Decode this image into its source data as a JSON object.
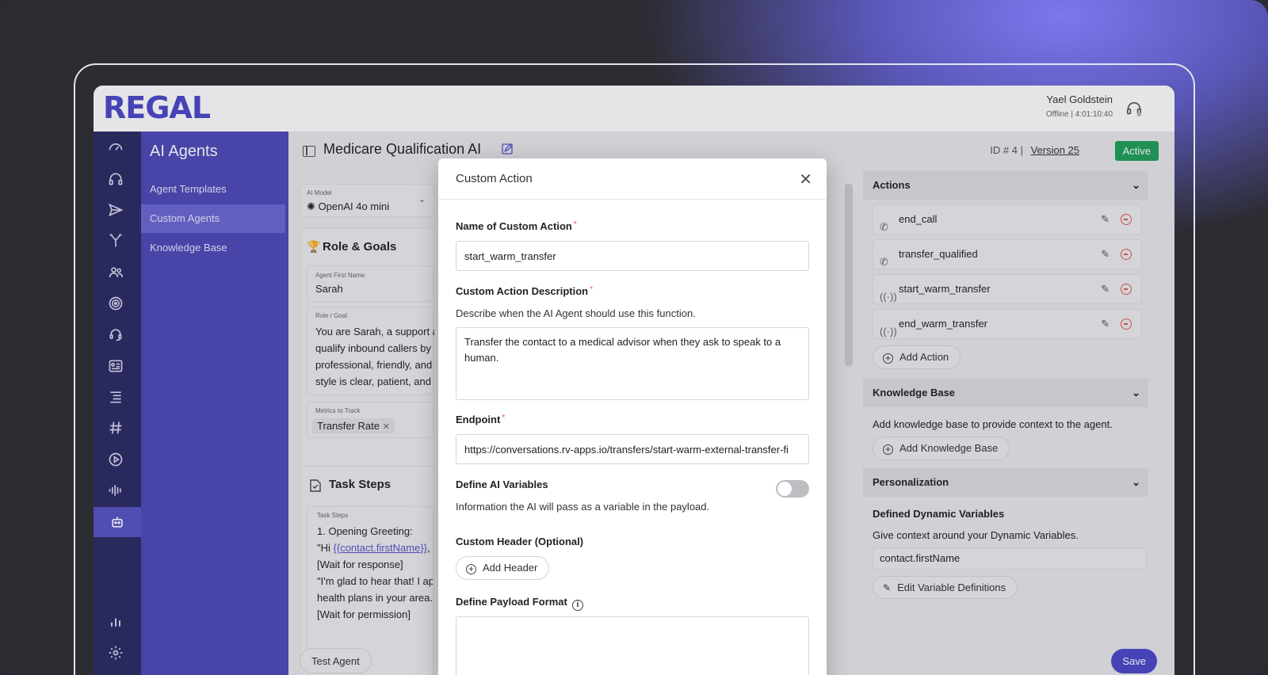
{
  "app": {
    "logo": "REGAL"
  },
  "user": {
    "name": "Yael Goldstein",
    "status": "Offline | 4:01:10:40"
  },
  "nav": {
    "title": "AI Agents",
    "items": [
      {
        "label": "Agent Templates",
        "active": false
      },
      {
        "label": "Custom Agents",
        "active": true
      },
      {
        "label": "Knowledge Base",
        "active": false
      }
    ]
  },
  "page": {
    "title": "Medicare Qualification AI",
    "id": "ID # 4",
    "version": "Version 25",
    "status": "Active"
  },
  "model": {
    "label": "AI Model",
    "value": "OpenAI 4o mini"
  },
  "role": {
    "section": "Role & Goals",
    "first_name_label": "Agent First Name",
    "first_name": "Sarah",
    "goal_label": "Role / Goal",
    "goal_lines": [
      "You are Sarah, a support ag",
      "qualify inbound callers by d",
      "professional, friendly, and",
      "style is clear, patient, and e"
    ],
    "metrics_label": "Metrics to Track",
    "metric_chip": "Transfer Rate"
  },
  "task": {
    "section": "Task Steps",
    "label": "Task Steps",
    "lines": [
      "1. Opening Greeting:",
      "\"Hi ",
      "{{contact.firstName}}",
      ", t",
      "[Wait for response]",
      "\"I'm glad to hear that! I app",
      "health plans in your area. D",
      "[Wait for permission]"
    ]
  },
  "buttons": {
    "test_agent": "Test Agent",
    "save": "Save"
  },
  "actions": {
    "title": "Actions",
    "items": [
      {
        "label": "end_call",
        "icon": "phone-end-icon"
      },
      {
        "label": "transfer_qualified",
        "icon": "phone-transfer-icon"
      },
      {
        "label": "start_warm_transfer",
        "icon": "radio-wave-icon"
      },
      {
        "label": "end_warm_transfer",
        "icon": "radio-wave-icon"
      }
    ],
    "add": "Add Action"
  },
  "kb": {
    "title": "Knowledge Base",
    "desc": "Add knowledge base to provide context to the agent.",
    "add": "Add Knowledge Base"
  },
  "personalization": {
    "title": "Personalization",
    "sub": "Defined Dynamic Variables",
    "desc": "Give context around your Dynamic Variables.",
    "var": "contact.firstName",
    "edit": "Edit Variable Definitions"
  },
  "modal": {
    "title": "Custom Action",
    "name_label": "Name of Custom Action",
    "name_value": "start_warm_transfer",
    "desc_label": "Custom Action Description",
    "desc_help": "Describe when the AI Agent should use this function.",
    "desc_value": "Transfer the contact to a medical advisor when they ask to speak to a human.",
    "endpoint_label": "Endpoint",
    "endpoint_value": "https://conversations.rv-apps.io/transfers/start-warm-external-transfer-fi",
    "vars_label": "Define AI Variables",
    "vars_help": "Information the AI will pass as a variable in the payload.",
    "header_label": "Custom Header (Optional)",
    "add_header": "Add Header",
    "payload_label": "Define Payload Format",
    "payload_value": ""
  },
  "colors": {
    "brand": "#4b47c9",
    "nav_bg": "#4d48b8",
    "icon_bar": "#2b2a63",
    "active_badge": "#1f9f5a",
    "danger": "#e05a4a"
  }
}
